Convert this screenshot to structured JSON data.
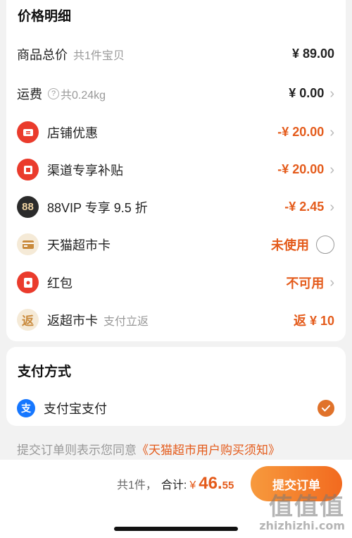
{
  "price_section": {
    "title": "价格明细",
    "rows": [
      {
        "label": "商品总价",
        "sub": "共1件宝贝",
        "value": "¥ 89.00"
      },
      {
        "label": "运费",
        "sub": "共0.24kg",
        "value": "¥ 0.00"
      },
      {
        "label": "店铺优惠",
        "value": "-¥ 20.00"
      },
      {
        "label": "渠道专享补贴",
        "value": "-¥ 20.00"
      },
      {
        "label": "88VIP 专享 9.5 折",
        "value": "-¥ 2.45"
      },
      {
        "label": "天猫超市卡",
        "value": "未使用"
      },
      {
        "label": "红包",
        "value": "不可用"
      },
      {
        "label": "返超市卡",
        "sub": "支付立返",
        "value": "返 ¥ 10"
      }
    ]
  },
  "icons": {
    "store": "store-discount-icon",
    "channel": "channel-subsidy-icon",
    "vip": "88",
    "card": "supermarket-card-icon",
    "redpacket": "red-packet-icon",
    "rebate": "返",
    "alipay": "支"
  },
  "payment_section": {
    "title": "支付方式",
    "method": "支付宝支付"
  },
  "agreement": {
    "text": "提交订单则表示您同意",
    "link": "《天猫超市用户购买须知》"
  },
  "bottom_bar": {
    "count": "共1件，",
    "total_label": "合计:",
    "currency": "¥",
    "total_int": "46.",
    "total_dec": "55",
    "submit_label": "提交订单"
  },
  "watermark": {
    "big": "值值值",
    "small": "zhizhizhi.com"
  },
  "colors": {
    "accent": "#e45b1b",
    "icon_red": "#ea3b2c",
    "alipay_blue": "#1677ff"
  }
}
